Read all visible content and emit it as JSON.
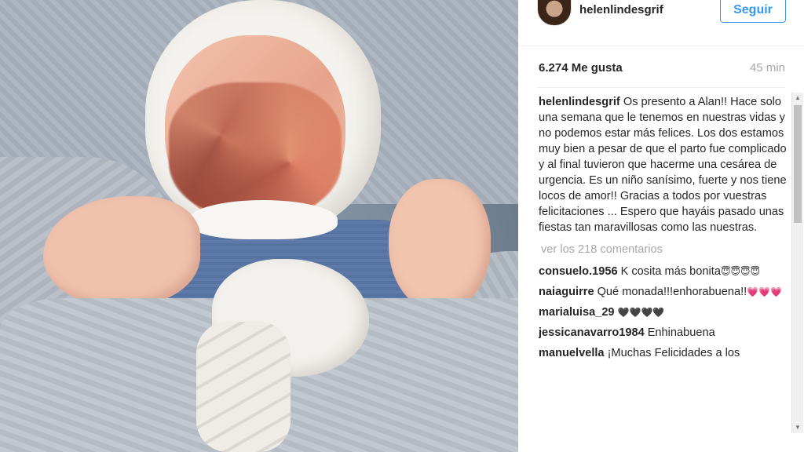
{
  "post": {
    "username": "helenlindesgrif",
    "follow_label": "Seguir",
    "likes": "6.274 Me gusta",
    "time_ago": "45 min",
    "caption_user": "helenlindesgrif",
    "caption_text": "Os presento a Alan!! Hace solo una semana que le tenemos en nuestras vidas y no podemos estar más felices. Los dos estamos muy bien a pesar de que el parto fue complicado y al final tuvieron que hacerme una cesárea de urgencia. Es un niño sanísimo, fuerte y nos tiene locos de amor!! Gracias a todos por vuestras felicitaciones ... Espero que hayáis pasado unas fiestas tan maravillosas como las nuestras.",
    "view_all_comments": "ver los 218 comentarios"
  },
  "comments": [
    {
      "user": "consuelo.1956",
      "text": "K cosita más bonita",
      "emoji": "😇😇😇😇"
    },
    {
      "user": "naiaguirre",
      "text": "Qué monada!!!enhorabuena!!",
      "emoji": "💗💗💗"
    },
    {
      "user": "marialuisa_29",
      "text": "",
      "emoji": "🖤🖤🖤🖤"
    },
    {
      "user": "jessicanavarro1984",
      "text": "Enhinabuena",
      "emoji": ""
    },
    {
      "user": "manuelvella",
      "text": "¡Muchas Felicidades a los",
      "emoji": ""
    }
  ],
  "icons": {
    "scroll_up": "scroll-up-arrow",
    "scroll_down": "scroll-down-arrow"
  },
  "colors": {
    "accent": "#3897f0",
    "text": "#262626",
    "muted": "#a5a7aa"
  }
}
